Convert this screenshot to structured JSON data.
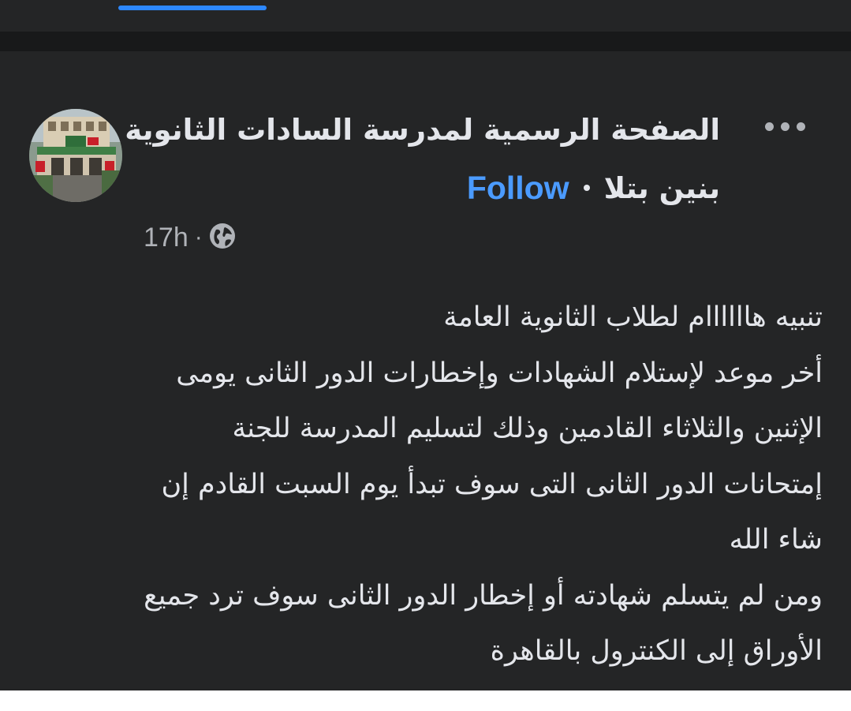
{
  "colors": {
    "background": "#242526",
    "separator": "#18191a",
    "text_primary": "#e4e6eb",
    "text_secondary": "#b0b3b8",
    "accent": "#4b9bff"
  },
  "post": {
    "author": "الصفحة الرسمية لمدرسة السادات الثانوية",
    "location": "بنين بتلا",
    "follow_label": "Follow",
    "time": "17h",
    "separator": "·",
    "audience_icon": "globe-icon",
    "more_icon": "more-options-icon",
    "lines": [
      "تنبيه هاااااام لطلاب الثانوية العامة",
      "أخر موعد لإستلام الشهادات وإخطارات الدور الثانى يومى",
      "الإثنين والثلاثاء القادمين وذلك لتسليم المدرسة للجنة",
      "إمتحانات الدور الثانى التى سوف تبدأ يوم السبت القادم إن",
      "شاء الله",
      "ومن لم يتسلم شهادته أو إخطار الدور الثانى سوف ترد جميع",
      "الأوراق إلى الكنترول بالقاهرة"
    ]
  }
}
